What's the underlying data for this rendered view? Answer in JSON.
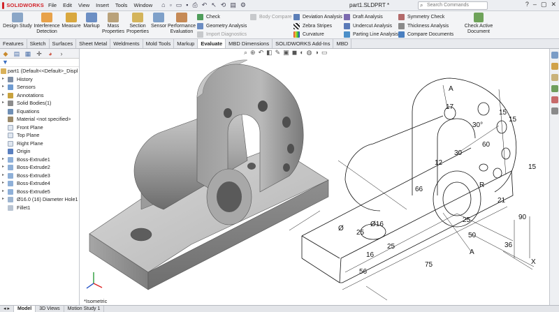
{
  "app": {
    "logo_text": "SOLIDWORKS",
    "doc_title": "part1.SLDPRT *"
  },
  "menu": [
    "File",
    "Edit",
    "View",
    "Insert",
    "Tools",
    "Window"
  ],
  "search": {
    "placeholder": "Search Commands"
  },
  "ribbon": {
    "design_study": "Design Study",
    "interference": "Interference Detection",
    "measure": "Measure",
    "markup": "Markup",
    "mass_props": "Mass Properties",
    "section_props": "Section Properties",
    "sensor": "Sensor",
    "perf_eval": "Performance Evaluation",
    "check": "Check",
    "geometry_analysis": "Geometry Analysis",
    "import_diagnostics": "Import Diagnostics",
    "body_compare": "Body Compare",
    "deviation": "Deviation Analysis",
    "zebra": "Zebra Stripes",
    "curvature": "Curvature",
    "draft": "Draft Analysis",
    "undercut": "Undercut Analysis",
    "parting": "Parting Line Analysis",
    "symmetry": "Symmetry Check",
    "thickness": "Thickness Analysis",
    "compare_docs": "Compare Documents",
    "check_active": "Check Active Document"
  },
  "cmd_tabs": [
    "Features",
    "Sketch",
    "Surfaces",
    "Sheet Metal",
    "Weldments",
    "Mold Tools",
    "Markup",
    "Evaluate",
    "MBD Dimensions",
    "SOLIDWORKS Add-Ins",
    "MBD"
  ],
  "cmd_tab_active": "Evaluate",
  "tree": {
    "root": "part1  (Default<<Default>_Displ",
    "items": [
      "History",
      "Sensors",
      "Annotations",
      "Solid Bodies(1)",
      "Equations",
      "Material <not specified>",
      "Front Plane",
      "Top Plane",
      "Right Plane",
      "Origin",
      "Boss-Extrude1",
      "Boss-Extrude2",
      "Boss-Extrude3",
      "Boss-Extrude4",
      "Boss-Extrude5",
      "Ø16.0 (16) Diameter Hole1",
      "Fillet1"
    ]
  },
  "viewport": {
    "view_label": "*Isometric"
  },
  "drawing_dims": [
    "A",
    "17",
    "15",
    "15",
    "30°",
    "60",
    "12",
    "30",
    "15",
    "66",
    "R",
    "21",
    "90",
    "25",
    "Ø16",
    "25",
    "50",
    "25",
    "A",
    "16",
    "36",
    "75",
    "56",
    "X",
    "Ø"
  ],
  "bottom_tabs": [
    "Model",
    "3D Views",
    "Motion Study 1"
  ],
  "bottom_tab_active": "Model"
}
